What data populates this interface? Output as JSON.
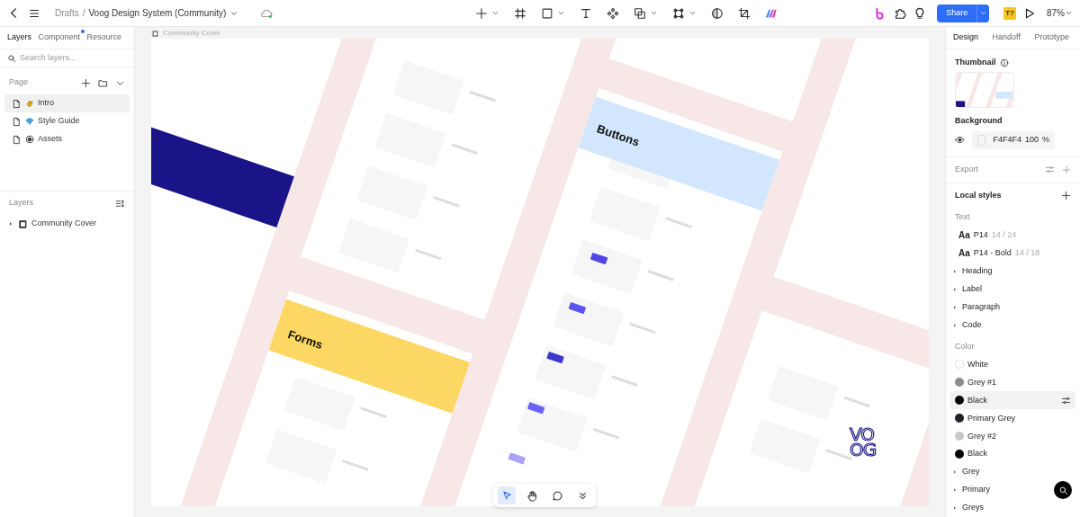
{
  "toolbar": {
    "breadcrumb_parent": "Drafts",
    "separator": "/",
    "file_name": "Voog Design System (Community)",
    "share_label": "Share",
    "font_badge": "T?",
    "zoom": "87%"
  },
  "left_panel": {
    "tabs": [
      {
        "label": "Layers",
        "selected": true,
        "notified": false
      },
      {
        "label": "Component",
        "selected": false,
        "notified": true
      },
      {
        "label": "Resource",
        "selected": false,
        "notified": false
      }
    ],
    "search": {
      "placeholder": "Search layers..."
    },
    "pages_title": "Page",
    "pages": [
      {
        "label": "Intro",
        "kind": "wave",
        "selected": true
      },
      {
        "label": "Style Guide",
        "kind": "gem",
        "selected": false
      },
      {
        "label": "Assets",
        "kind": "target",
        "selected": false
      }
    ],
    "layers_title": "Layers",
    "layers": [
      {
        "label": "Community Cover",
        "expanded": false
      }
    ]
  },
  "canvas": {
    "frame_label": "Community Cover",
    "headings": [
      "Buttons",
      "Forms"
    ],
    "logo_lines": [
      "VO",
      "OG"
    ]
  },
  "bottom_tools": [
    {
      "kind": "pointer",
      "selected": true
    },
    {
      "kind": "hand",
      "selected": false
    },
    {
      "kind": "comment",
      "selected": false
    },
    {
      "kind": "more",
      "selected": false
    }
  ],
  "right_panel": {
    "tabs": [
      {
        "label": "Design",
        "selected": true
      },
      {
        "label": "Handoff",
        "selected": false
      },
      {
        "label": "Prototype",
        "selected": false
      }
    ],
    "thumbnail_title": "Thumbnail",
    "background_title": "Background",
    "background": {
      "hex": "F4F4F4",
      "opacity": "100",
      "unit": "%",
      "visible": true
    },
    "export_title": "Export",
    "local_styles_title": "Local styles",
    "text_title": "Text",
    "text_styles": [
      {
        "sample": "Aa",
        "name": "P14",
        "metrics": "14 / 24"
      },
      {
        "sample": "Aa",
        "name": "P14 - Bold",
        "metrics": "14 / 18"
      }
    ],
    "text_groups": [
      {
        "label": "Heading",
        "expanded": false
      },
      {
        "label": "Label",
        "expanded": false
      },
      {
        "label": "Paragraph",
        "expanded": false
      },
      {
        "label": "Code",
        "expanded": false
      }
    ],
    "color_title": "Color",
    "colors": [
      {
        "name": "White",
        "color": "#ffffff",
        "selected": false
      },
      {
        "name": "Grey #1",
        "color": "#8c8c8c",
        "selected": false
      },
      {
        "name": "Black",
        "color": "#000000",
        "selected": true
      },
      {
        "name": "Primary Grey",
        "color": "#1f2328",
        "selected": false
      },
      {
        "name": "Grey #2",
        "color": "#c8c8c8",
        "selected": false
      },
      {
        "name": "Black",
        "color": "#000000",
        "selected": false
      }
    ],
    "color_groups": [
      {
        "label": "Grey",
        "expanded": false
      },
      {
        "label": "Primary",
        "expanded": false
      },
      {
        "label": "Greys",
        "expanded": false
      }
    ]
  }
}
